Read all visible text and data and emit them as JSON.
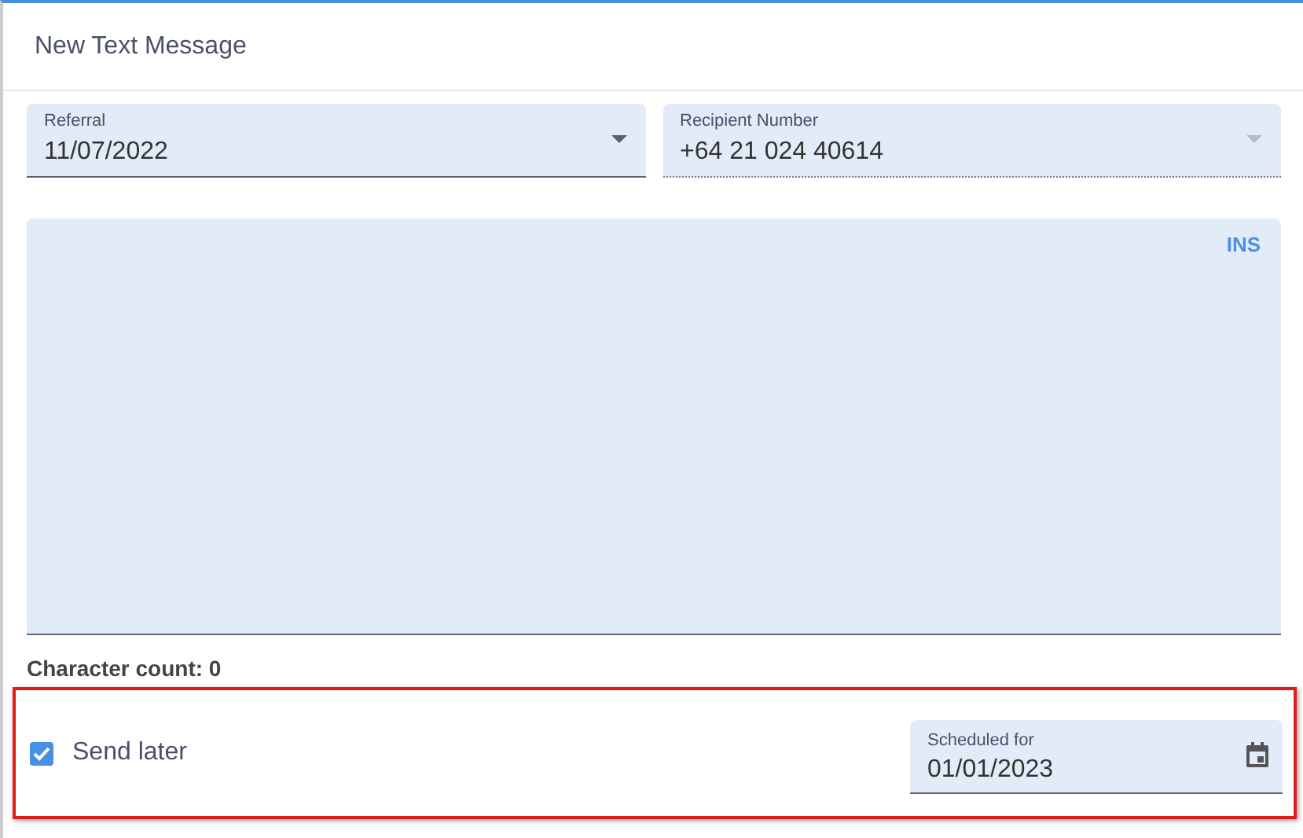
{
  "dialog": {
    "title": "New Text Message"
  },
  "fields": [
    {
      "label": "Referral",
      "value": "11/07/2022",
      "disabled": false
    },
    {
      "label": "Recipient Number",
      "value": "+64 21 024 40614",
      "disabled": true
    }
  ],
  "message": {
    "mode": "INS"
  },
  "character_count": "Character count: 0",
  "highlight": {
    "send_later": {
      "label": "Send later",
      "checked": true
    },
    "scheduled": {
      "label": "Scheduled for",
      "value": "01/01/2023"
    }
  }
}
